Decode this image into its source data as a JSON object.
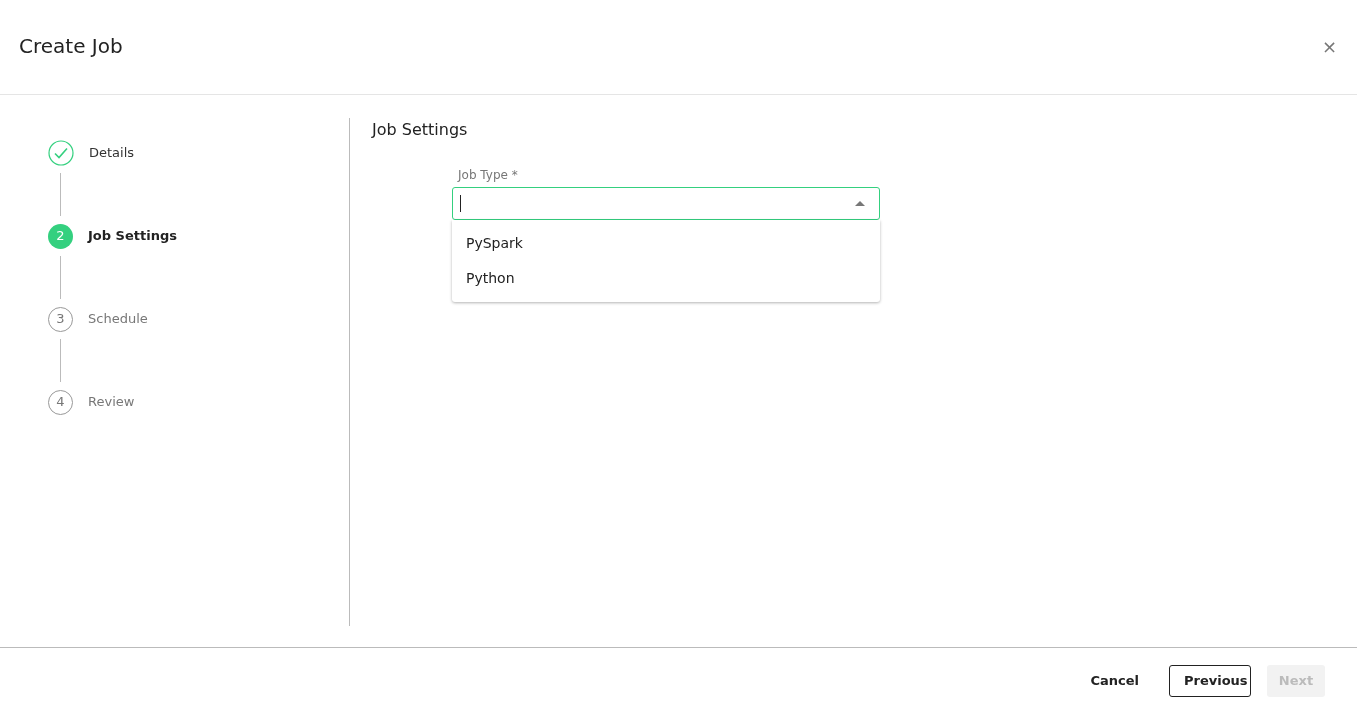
{
  "dialog": {
    "title": "Create Job",
    "close": "×"
  },
  "steps": [
    {
      "kind": "done",
      "label": "Details",
      "selected": false
    },
    {
      "kind": "numbered",
      "number": "2",
      "label": "Job Settings",
      "selected": true
    },
    {
      "kind": "numbered",
      "number": "3",
      "label": "Schedule",
      "selected": false
    },
    {
      "kind": "numbered",
      "number": "4",
      "label": "Review",
      "selected": false
    }
  ],
  "section": {
    "title": "Job Settings",
    "field": {
      "label": "Job Type *",
      "focused": true,
      "expanded": true,
      "options": [
        "PySpark",
        "Python"
      ]
    }
  },
  "footer": {
    "buttons": [
      {
        "kind": "text",
        "label": "Cancel",
        "disabled": false
      },
      {
        "kind": "outline",
        "label": "Previous",
        "disabled": false
      },
      {
        "kind": "filled",
        "label": "Next",
        "disabled": true
      }
    ]
  }
}
